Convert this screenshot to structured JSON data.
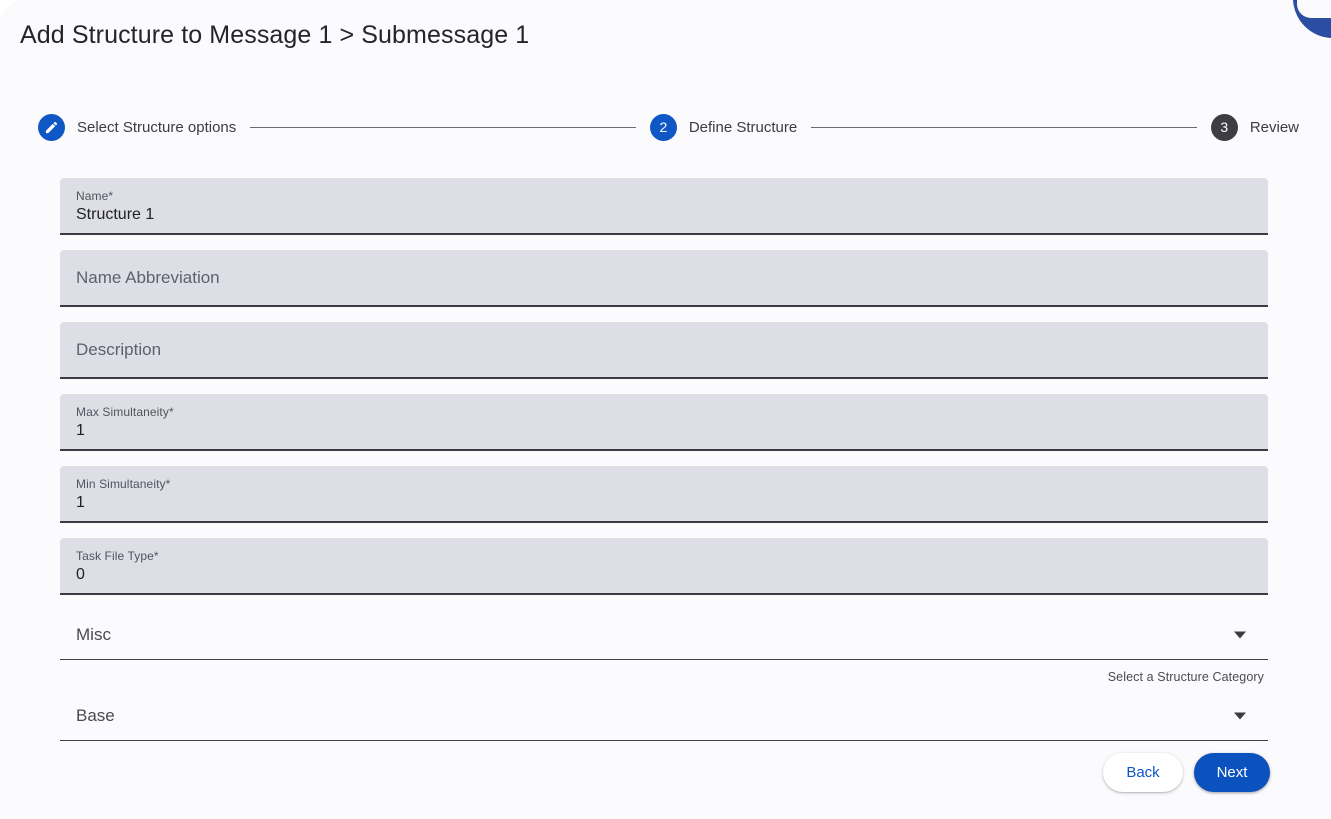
{
  "page": {
    "title": "Add Structure to Message 1 > Submessage 1"
  },
  "stepper": {
    "steps": [
      {
        "marker": "",
        "icon": "pencil-icon",
        "label": "Select Structure options",
        "state": "done"
      },
      {
        "marker": "2",
        "icon": "",
        "label": "Define Structure",
        "state": "active"
      },
      {
        "marker": "3",
        "icon": "",
        "label": "Review",
        "state": "todo"
      }
    ]
  },
  "form": {
    "fields": [
      {
        "label": "Name*",
        "value": "Structure 1",
        "placeholder": ""
      },
      {
        "label": "",
        "value": "",
        "placeholder": "Name Abbreviation"
      },
      {
        "label": "",
        "value": "",
        "placeholder": "Description"
      },
      {
        "label": "Max Simultaneity*",
        "value": "1",
        "placeholder": ""
      },
      {
        "label": "Min Simultaneity*",
        "value": "1",
        "placeholder": ""
      },
      {
        "label": "Task File Type*",
        "value": "0",
        "placeholder": ""
      }
    ],
    "selects": [
      {
        "value": "Misc",
        "hint": "Select a Structure Category"
      },
      {
        "value": "Base",
        "hint": ""
      }
    ]
  },
  "actions": {
    "back_label": "Back",
    "next_label": "Next"
  },
  "colors": {
    "accent": "#0f57c4",
    "next_button": "#0b52bf",
    "step_todo": "#3d3d43",
    "field_background": "#dddee6",
    "page_background": "#fbfafc"
  }
}
